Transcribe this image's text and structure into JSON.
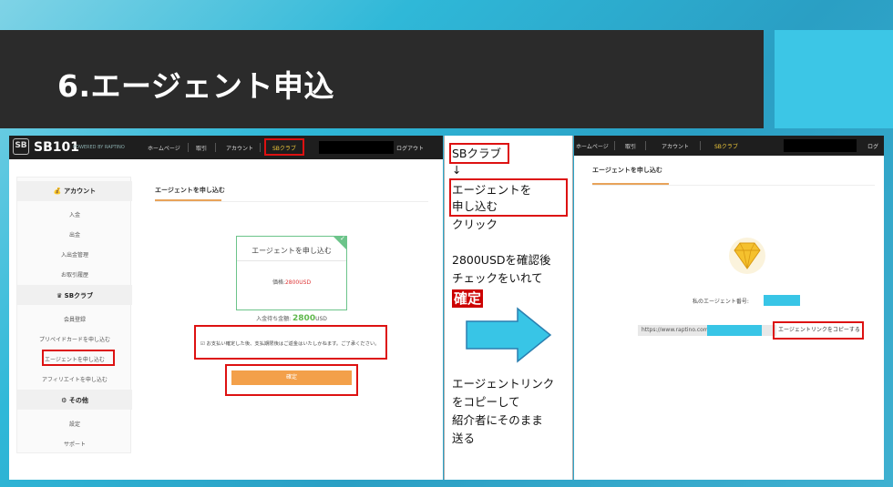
{
  "slide": {
    "title": "6.エージェント申込"
  },
  "left_screen": {
    "logo": "SB101",
    "logo_icon": "SB",
    "logo_sub": "POWERED BY RAPTINO",
    "nav": [
      "ホームページ",
      "取引",
      "アカウント",
      "SBクラブ",
      "ログアウト"
    ],
    "sidebar": {
      "sections": [
        {
          "heading": "アカウント",
          "icon": "money-bag-icon",
          "items": [
            "入金",
            "出金",
            "入出金管理",
            "お取引履歴"
          ]
        },
        {
          "heading": "SBクラブ",
          "icon": "crown-icon",
          "items": [
            "会員登録",
            "プリペイドカードを申し込む",
            "エージェントを申し込む",
            "アフィリエイトを申し込む"
          ]
        },
        {
          "heading": "その他",
          "icon": "gear-icon",
          "items": [
            "設定",
            "サポート"
          ]
        }
      ]
    },
    "content_title": "エージェントを申し込む",
    "card": {
      "title": "エージェントを申し込む",
      "price_label": "価格:",
      "price_value": "2800USD"
    },
    "amount": {
      "label": "入金待ち金額:",
      "value": "2800",
      "unit": "USD"
    },
    "agree_text": "お支払い確定した後、支払期限後はご返金はいたしかねます。ご了承ください。",
    "confirm_button": "確定"
  },
  "instructions": {
    "step1": "SBクラブ",
    "arrow_down": "↓",
    "step2_line1": "エージェントを",
    "step2_line2": "申し込む",
    "step2_line3": "クリック",
    "step3_line1": "2800USDを確認後",
    "step3_line2": "チェックをいれて",
    "step3_highlight": "確定",
    "step4_line1": "エージェントリンク",
    "step4_line2": "をコピーして",
    "step4_line3": "紹介者にそのまま",
    "step4_line4": "送る"
  },
  "right_screen": {
    "nav": [
      "ホームページ",
      "取引",
      "アカウント",
      "SBクラブ",
      "ログ"
    ],
    "content_title": "エージェントを申し込む",
    "agent_no_label": "私のエージェント番号:",
    "url_prefix": "https://www.raptino.com/",
    "copy_button": "エージェントリンクをコピーする"
  },
  "colors": {
    "title_bar": "#2b2b2b",
    "accent_cyan": "#38c5e6",
    "highlight_red": "#cc0000",
    "confirm_orange": "#f3a04a",
    "card_green": "#6cc48a"
  }
}
